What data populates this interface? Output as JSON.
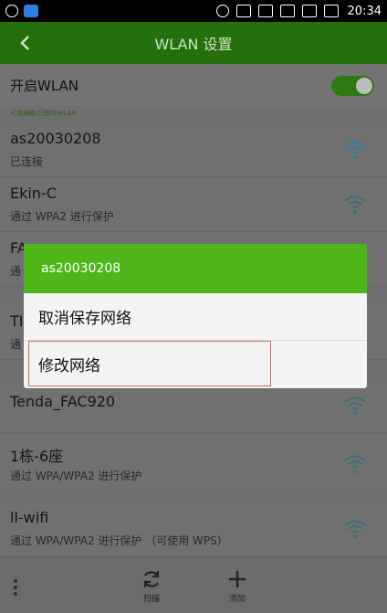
{
  "status_bar": {
    "time": "20:34"
  },
  "header": {
    "title": "WLAN 设置"
  },
  "wlan_toggle": {
    "label": "开启WLAN",
    "on": true
  },
  "section_label": "可用网络/已保存WLAN",
  "networks": [
    {
      "name": "as20030208",
      "status": "已连接"
    },
    {
      "name": "Ekin-C",
      "status": "通过 WPA2 进行保护"
    },
    {
      "name": "FA",
      "status": "通"
    },
    {
      "name": "TI",
      "status": "通"
    },
    {
      "name": "Tenda_FAC920",
      "status": ""
    },
    {
      "name": "1栋-6座",
      "status": "通过 WPA/WPA2 进行保护"
    },
    {
      "name": "ll-wifi",
      "status": "通过 WPA/WPA2 进行保护 （可使用 WPS）"
    }
  ],
  "dialog": {
    "title": "as20030208",
    "items": [
      "取消保存网络",
      "修改网络"
    ]
  },
  "bottom_bar": {
    "scan_label": "扫描",
    "add_label": "添加"
  },
  "colors": {
    "accent": "#4db71a",
    "title_bar": "#256f0c"
  }
}
